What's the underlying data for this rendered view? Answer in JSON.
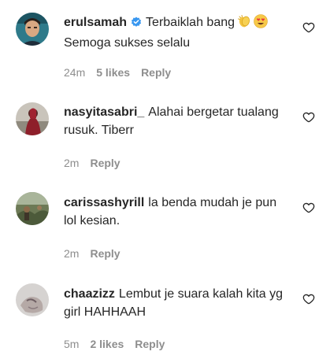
{
  "colors": {
    "text": "#262626",
    "meta": "#8e8e8e",
    "verified": "#3897f0"
  },
  "comments": [
    {
      "username": "erulsamah",
      "verified": true,
      "text_lines": [
        "Terbaiklah bang",
        "Semoga sukses selalu"
      ],
      "emojis": [
        "clapping-hands",
        "heart-eyes"
      ],
      "time": "24m",
      "likes": "5 likes",
      "reply": "Reply"
    },
    {
      "username": "nasyitasabri_",
      "verified": false,
      "text": "Alahai bergetar tualang rusuk. Tiberr",
      "time": "2m",
      "reply": "Reply"
    },
    {
      "username": "carissashyrill",
      "verified": false,
      "text": "la benda mudah je pun lol kesian.",
      "time": "2m",
      "reply": "Reply"
    },
    {
      "username": "chaazizz",
      "verified": false,
      "text": "Lembut je suara kalah kita yg girl HAHHAAH",
      "time": "5m",
      "likes": "2 likes",
      "reply": "Reply"
    }
  ]
}
